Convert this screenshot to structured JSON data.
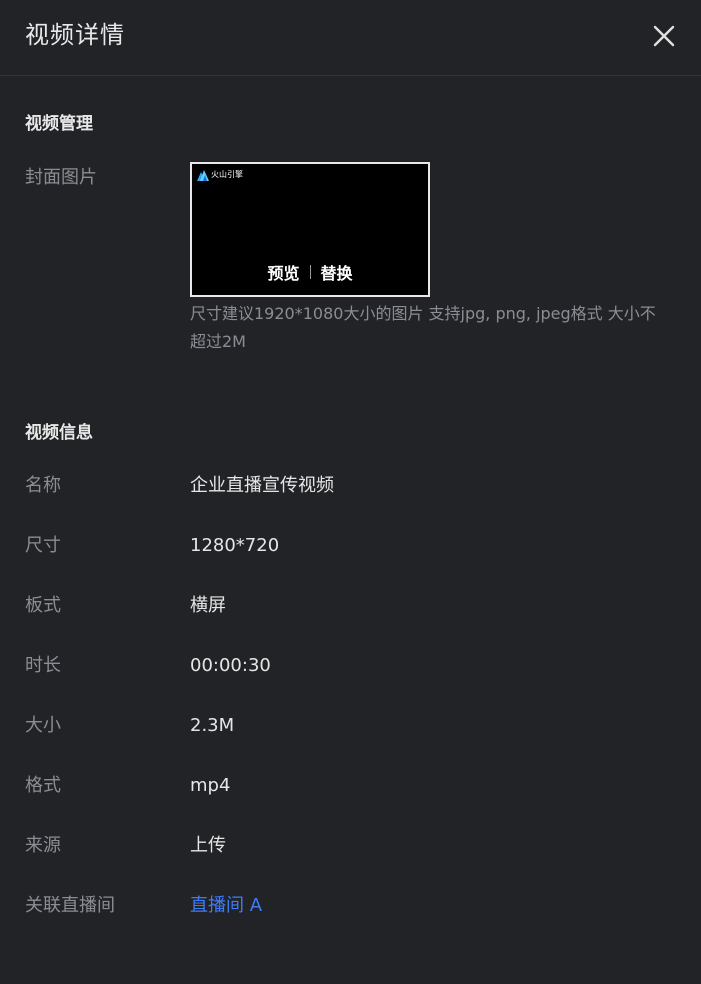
{
  "header": {
    "title": "视频详情",
    "close_icon": "close-icon"
  },
  "manage": {
    "section_title": "视频管理",
    "cover_label": "封面图片",
    "brand_text": "火山引擎",
    "preview_label": "预览",
    "replace_label": "替换",
    "hint": "尺寸建议1920*1080大小的图片   支持jpg, png, jpeg格式   大小不超过2M"
  },
  "info": {
    "section_title": "视频信息",
    "rows": [
      {
        "label": "名称",
        "value": "企业直播宣传视频"
      },
      {
        "label": "尺寸",
        "value": "1280*720"
      },
      {
        "label": "板式",
        "value": "横屏"
      },
      {
        "label": "时长",
        "value": "00:00:30"
      },
      {
        "label": "大小",
        "value": "2.3M"
      },
      {
        "label": "格式",
        "value": "mp4"
      },
      {
        "label": "来源",
        "value": "上传"
      },
      {
        "label": "关联直播间",
        "value": "直播间 A"
      }
    ]
  },
  "colors": {
    "background": "#222327",
    "link": "#3e7cf7",
    "label": "#8a8d93",
    "brand_logo": "#2aa7f5"
  }
}
